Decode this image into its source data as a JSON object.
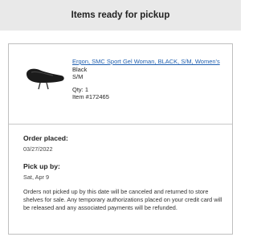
{
  "header": {
    "title": "Items ready for pickup"
  },
  "item": {
    "image_icon": "saddle-product-image",
    "name": "Ergon, SMC Sport Gel Woman, BLACK, S/M, Women's",
    "color": "Black",
    "size": "S/M",
    "qty": "Qty: 1",
    "item_number": "Item #172465"
  },
  "order": {
    "placed_label": "Order placed:",
    "placed_date": "03/27/2022",
    "pickup_label": "Pick up by:",
    "pickup_date": "Sat, Apr 9",
    "note": "Orders not picked up by this date will be canceled and returned to store shelves for sale. Any temporary authorizations placed on your credit card will be released and any associated payments will be refunded."
  }
}
